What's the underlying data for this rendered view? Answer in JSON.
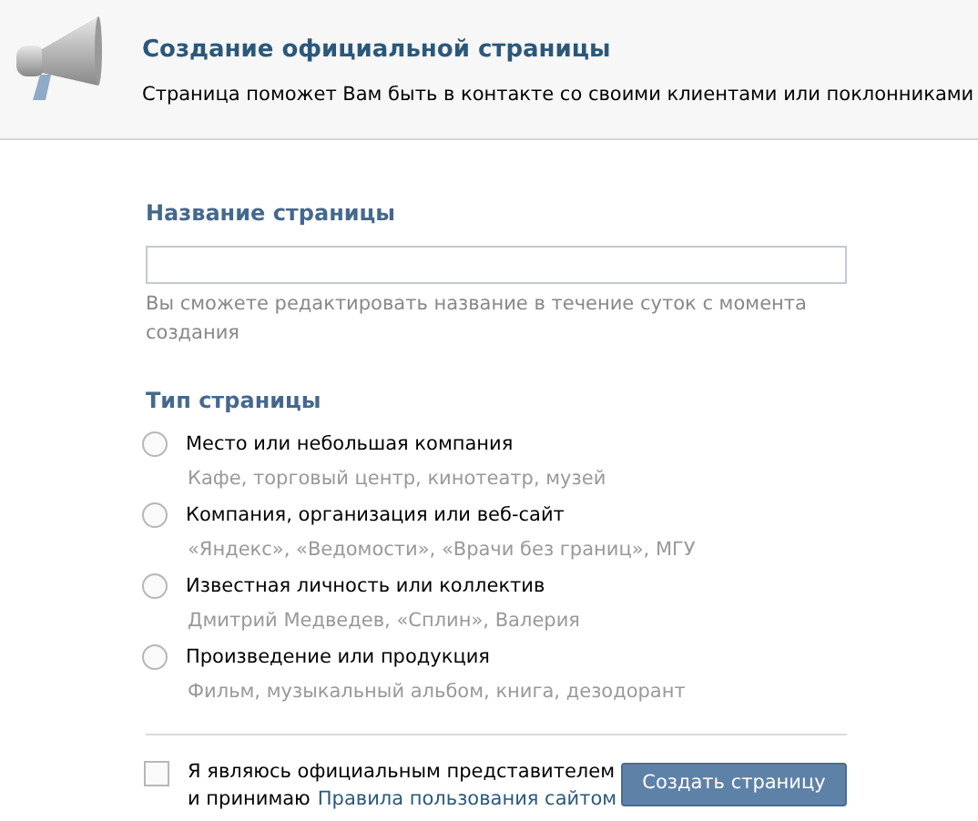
{
  "header": {
    "title": "Создание официальной страницы",
    "subtitle": "Страница поможет Вам быть в контакте со своими клиентами или поклонниками"
  },
  "name_section": {
    "heading": "Название страницы",
    "hint": "Вы сможете редактировать название в течение суток с момента создания"
  },
  "type_section": {
    "heading": "Тип страницы",
    "options": [
      {
        "label": "Место или небольшая компания",
        "examples": "Кафе, торговый центр, кинотеатр, музей",
        "selected": false
      },
      {
        "label": "Компания, организация или веб-сайт",
        "examples": "«Яндекс», «Ведомости», «Врачи без границ», МГУ",
        "selected": false
      },
      {
        "label": "Известная личность или коллектив",
        "examples": "Дмитрий Медведев, «Сплин», Валерия",
        "selected": false
      },
      {
        "label": "Произведение или продукция",
        "examples": "Фильм, музыкальный альбом, книга, дезодорант",
        "selected": false
      }
    ]
  },
  "agreement": {
    "checked": false,
    "line_1": "Я являюсь официальным представителем",
    "line_2_prefix": "и принимаю",
    "link": "Правила пользования сайтом"
  },
  "submit_button": "Создать страницу"
}
